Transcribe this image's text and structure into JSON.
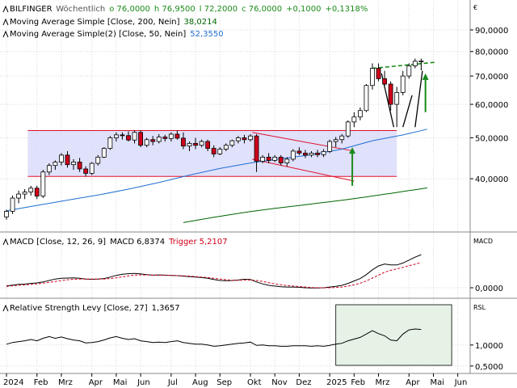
{
  "header": {
    "name": "BILFINGER",
    "interval": "Wöchentlich",
    "open": "o 76,0000",
    "high": "h 76,9500",
    "low": "l 72,2000",
    "close": "c 76,0000",
    "change": "+0,1000",
    "change_pct": "+0,1318%"
  },
  "legend": [
    {
      "label": "Moving Average Simple [Close, 200, Nein]",
      "value": "38,0214",
      "color": "#006400"
    },
    {
      "label": "Moving Average Simple(2) [Close, 50, Nein]",
      "value": "52,3550",
      "color": "#1f6fd1"
    }
  ],
  "colors": {
    "up": "#ffffff",
    "down": "#d0021b",
    "channel_fill": "#dadcfa",
    "channel_line": "#e0102a",
    "arrow": "#1a8a1a",
    "dashed": "#1a8a1a",
    "ma200": "#006400",
    "ma50": "#1f6fd1",
    "macd": "#000000",
    "trigger": "#d0021b",
    "rsl_box": "#e6f2e6"
  },
  "chart_data": [
    {
      "type": "candlestick",
      "title": "BILFINGER",
      "currency_label": "€",
      "y_ticks": [
        "90,0000",
        "80,0000",
        "70,0000",
        "60,0000",
        "50,0000",
        "40,0000"
      ],
      "y_tick_values": [
        90,
        80,
        70,
        60,
        50,
        40
      ],
      "ylim": [
        31,
        97
      ],
      "log_scale": true,
      "x_labels": [
        "2024",
        "Feb",
        "Mrz",
        "Apr",
        "Mai",
        "Jun",
        "Jul",
        "Aug",
        "Sep",
        "Okt",
        "Nov",
        "Dez",
        "2025",
        "Feb",
        "Mrz",
        "Apr",
        "Mai",
        "Jun"
      ],
      "x_label_weeks": [
        0,
        5,
        9,
        14,
        18,
        22,
        27,
        31,
        35,
        40,
        44,
        48,
        53,
        57,
        61,
        66,
        70,
        74
      ],
      "total_weeks": 78,
      "candles": [
        [
          32.5,
          33.8,
          32.0,
          33.5
        ],
        [
          33.5,
          36.5,
          33.0,
          36.0
        ],
        [
          36.0,
          37.5,
          35.0,
          36.8
        ],
        [
          36.8,
          37.8,
          35.8,
          37.2
        ],
        [
          37.2,
          38.5,
          36.5,
          38.0
        ],
        [
          38.0,
          38.5,
          35.8,
          36.4
        ],
        [
          36.4,
          42.0,
          36.0,
          41.5
        ],
        [
          41.5,
          43.5,
          40.8,
          43.0
        ],
        [
          43.0,
          44.2,
          42.0,
          43.8
        ],
        [
          43.8,
          46.0,
          43.0,
          45.5
        ],
        [
          45.5,
          46.5,
          42.5,
          43.2
        ],
        [
          43.2,
          44.5,
          42.0,
          43.8
        ],
        [
          43.8,
          44.8,
          41.5,
          42.2
        ],
        [
          42.2,
          42.8,
          40.5,
          41.2
        ],
        [
          41.2,
          43.8,
          40.8,
          43.5
        ],
        [
          43.5,
          45.5,
          43.0,
          45.0
        ],
        [
          45.0,
          47.5,
          44.8,
          47.2
        ],
        [
          47.2,
          50.5,
          46.8,
          50.0
        ],
        [
          50.0,
          51.5,
          49.0,
          50.8
        ],
        [
          50.8,
          51.5,
          49.5,
          50.6
        ],
        [
          50.6,
          51.8,
          49.0,
          49.4
        ],
        [
          49.4,
          52.0,
          48.5,
          51.5
        ],
        [
          51.5,
          52.0,
          47.5,
          48.0
        ],
        [
          48.0,
          50.0,
          47.5,
          49.5
        ],
        [
          49.5,
          50.5,
          48.0,
          49.0
        ],
        [
          49.0,
          51.0,
          48.5,
          50.2
        ],
        [
          50.2,
          50.8,
          49.0,
          49.8
        ],
        [
          49.8,
          51.5,
          49.0,
          51.0
        ],
        [
          51.0,
          52.0,
          49.5,
          49.9
        ],
        [
          49.9,
          51.5,
          47.0,
          47.8
        ],
        [
          47.8,
          49.0,
          46.5,
          48.5
        ],
        [
          48.5,
          50.0,
          47.0,
          48.0
        ],
        [
          48.0,
          49.5,
          47.5,
          49.0
        ],
        [
          49.0,
          49.5,
          46.5,
          47.2
        ],
        [
          47.2,
          48.0,
          45.0,
          45.8
        ],
        [
          45.8,
          47.5,
          45.5,
          47.0
        ],
        [
          47.0,
          48.5,
          46.5,
          48.0
        ],
        [
          48.0,
          49.5,
          47.5,
          49.2
        ],
        [
          49.2,
          50.5,
          48.5,
          50.0
        ],
        [
          50.0,
          50.8,
          48.5,
          49.5
        ],
        [
          49.5,
          51.0,
          49.0,
          50.5
        ],
        [
          50.5,
          51.0,
          41.5,
          44.0
        ],
        [
          44.0,
          45.5,
          43.5,
          45.0
        ],
        [
          45.0,
          46.0,
          43.5,
          44.2
        ],
        [
          44.2,
          45.5,
          43.8,
          45.0
        ],
        [
          45.0,
          45.5,
          43.0,
          43.6
        ],
        [
          43.6,
          45.0,
          42.8,
          44.5
        ],
        [
          44.5,
          47.0,
          44.0,
          46.5
        ],
        [
          46.5,
          47.5,
          45.5,
          46.0
        ],
        [
          46.0,
          46.8,
          44.8,
          45.5
        ],
        [
          45.5,
          46.5,
          45.0,
          46.0
        ],
        [
          46.0,
          46.8,
          45.0,
          45.6
        ],
        [
          45.6,
          47.0,
          45.0,
          46.4
        ],
        [
          46.4,
          49.5,
          46.0,
          49.0
        ],
        [
          49.0,
          50.2,
          47.5,
          49.5
        ],
        [
          49.5,
          51.0,
          48.5,
          50.5
        ],
        [
          50.5,
          55.0,
          50.0,
          54.5
        ],
        [
          54.5,
          57.5,
          53.0,
          56.0
        ],
        [
          56.0,
          59.0,
          55.0,
          58.0
        ],
        [
          58.0,
          67.0,
          57.5,
          66.5
        ],
        [
          66.5,
          75.0,
          65.0,
          73.0
        ],
        [
          73.0,
          75.0,
          68.0,
          69.0
        ],
        [
          69.0,
          72.0,
          66.0,
          67.0
        ],
        [
          67.0,
          68.0,
          58.0,
          60.0
        ],
        [
          60.0,
          66.0,
          53.0,
          64.0
        ],
        [
          64.0,
          72.0,
          63.0,
          70.0
        ],
        [
          70.0,
          75.0,
          69.0,
          74.0
        ],
        [
          74.0,
          77.0,
          73.0,
          75.9
        ],
        [
          75.9,
          76.95,
          72.2,
          76.0
        ]
      ]
    },
    {
      "type": "line",
      "title": "MACD",
      "legend": "MACD [Close, 12, 26, 9]",
      "macd_label": "MACD",
      "macd_value": "6,8374",
      "trigger_label": "Trigger",
      "trigger_value": "5,2107",
      "axis_label": "MACD",
      "y_ticks": [
        "0,0000"
      ],
      "y_tick_values": [
        0
      ],
      "ylim": [
        -1.0,
        8.0
      ],
      "series": [
        {
          "name": "MACD",
          "values": [
            0.4,
            0.55,
            0.7,
            0.75,
            0.9,
            1.0,
            1.2,
            1.5,
            1.8,
            1.95,
            2.0,
            2.05,
            1.95,
            1.8,
            1.75,
            1.8,
            1.9,
            2.2,
            2.55,
            2.8,
            2.9,
            2.95,
            2.85,
            2.7,
            2.6,
            2.65,
            2.6,
            2.55,
            2.5,
            2.4,
            2.3,
            2.2,
            2.1,
            1.95,
            1.7,
            1.5,
            1.45,
            1.5,
            1.6,
            1.75,
            1.7,
            1.2,
            0.8,
            0.5,
            0.35,
            0.2,
            0.15,
            0.15,
            0.1,
            0.0,
            -0.05,
            -0.05,
            0.0,
            0.15,
            0.3,
            0.5,
            0.9,
            1.4,
            1.9,
            2.7,
            3.7,
            4.5,
            4.9,
            4.7,
            4.7,
            5.1,
            5.7,
            6.3,
            6.84
          ]
        },
        {
          "name": "Trigger",
          "values": [
            0.3,
            0.4,
            0.5,
            0.6,
            0.7,
            0.8,
            0.95,
            1.1,
            1.3,
            1.5,
            1.65,
            1.75,
            1.8,
            1.8,
            1.8,
            1.8,
            1.8,
            1.9,
            2.05,
            2.25,
            2.45,
            2.6,
            2.65,
            2.65,
            2.6,
            2.6,
            2.6,
            2.55,
            2.5,
            2.45,
            2.4,
            2.3,
            2.2,
            2.1,
            1.95,
            1.8,
            1.65,
            1.55,
            1.55,
            1.6,
            1.6,
            1.5,
            1.3,
            1.05,
            0.8,
            0.6,
            0.45,
            0.35,
            0.25,
            0.15,
            0.05,
            0.0,
            0.0,
            0.0,
            0.05,
            0.15,
            0.35,
            0.6,
            0.95,
            1.4,
            2.0,
            2.6,
            3.2,
            3.6,
            3.9,
            4.2,
            4.55,
            4.85,
            5.21
          ]
        }
      ]
    },
    {
      "type": "line",
      "title": "Relative Strength Levy",
      "legend": "Relative Strength Levy [Close, 27]",
      "value": "1,3657",
      "axis_label": "RSL",
      "y_ticks": [
        "1,0000",
        "0,5000"
      ],
      "y_tick_values": [
        1.0,
        0.5
      ],
      "ylim": [
        0.4,
        1.9
      ],
      "series": [
        {
          "name": "RSL",
          "values": [
            1.02,
            1.06,
            1.08,
            1.1,
            1.13,
            1.1,
            1.16,
            1.2,
            1.16,
            1.19,
            1.15,
            1.12,
            1.1,
            1.05,
            1.06,
            1.08,
            1.12,
            1.17,
            1.2,
            1.16,
            1.13,
            1.15,
            1.1,
            1.08,
            1.06,
            1.07,
            1.06,
            1.08,
            1.1,
            1.06,
            1.04,
            1.02,
            1.02,
            1.0,
            0.97,
            0.98,
            1.0,
            1.02,
            1.04,
            1.05,
            1.07,
            0.99,
            1.0,
            0.98,
            0.98,
            0.97,
            0.97,
            0.98,
            0.98,
            0.98,
            0.97,
            0.98,
            0.97,
            0.99,
            1.02,
            1.04,
            1.1,
            1.14,
            1.18,
            1.26,
            1.34,
            1.27,
            1.22,
            1.12,
            1.1,
            1.26,
            1.36,
            1.38,
            1.37
          ]
        }
      ]
    }
  ]
}
